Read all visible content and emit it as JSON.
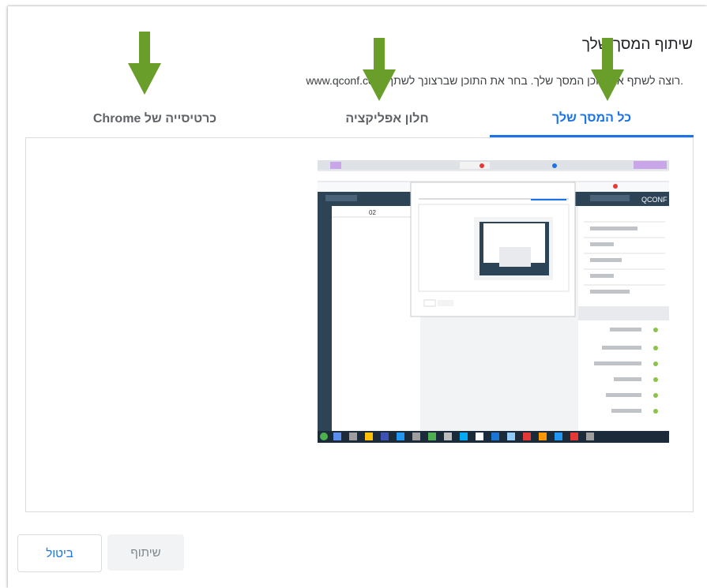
{
  "dialog": {
    "title": "שיתוף המסך שלך",
    "subtitle": ".רוצה לשתף את תוכן המסך שלך. בחר את התוכן שברצונך לשתף www.qconf.com"
  },
  "tabs": [
    {
      "label": "כל המסך שלך",
      "active": true
    },
    {
      "label": "חלון אפליקציה",
      "active": false
    },
    {
      "label": "כרטיסייה של Chrome",
      "active": false
    }
  ],
  "preview": {
    "app_name": "QCONF",
    "page_number": "02"
  },
  "buttons": {
    "share_label": "שיתוף",
    "cancel_label": "ביטול"
  },
  "colors": {
    "accent": "#1a73e8",
    "annotation_arrow": "#6a9e2a",
    "preview_app_bar": "#2d4356"
  },
  "icons": [
    "arrow-down-icon"
  ]
}
